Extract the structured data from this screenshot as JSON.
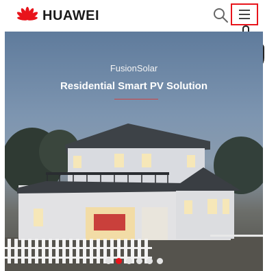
{
  "header": {
    "brand": "HUAWEI",
    "icons": {
      "logo": "huawei-flower-logo",
      "search": "search-icon",
      "menu": "hamburger-menu-icon",
      "pointer": "hand-pointer-icon"
    },
    "accent_color": "#e8141b"
  },
  "hero": {
    "subtitle": "FusionSolar",
    "title": "Residential Smart PV Solution",
    "carousel": {
      "slide_count": 6,
      "active_index": 1
    }
  }
}
